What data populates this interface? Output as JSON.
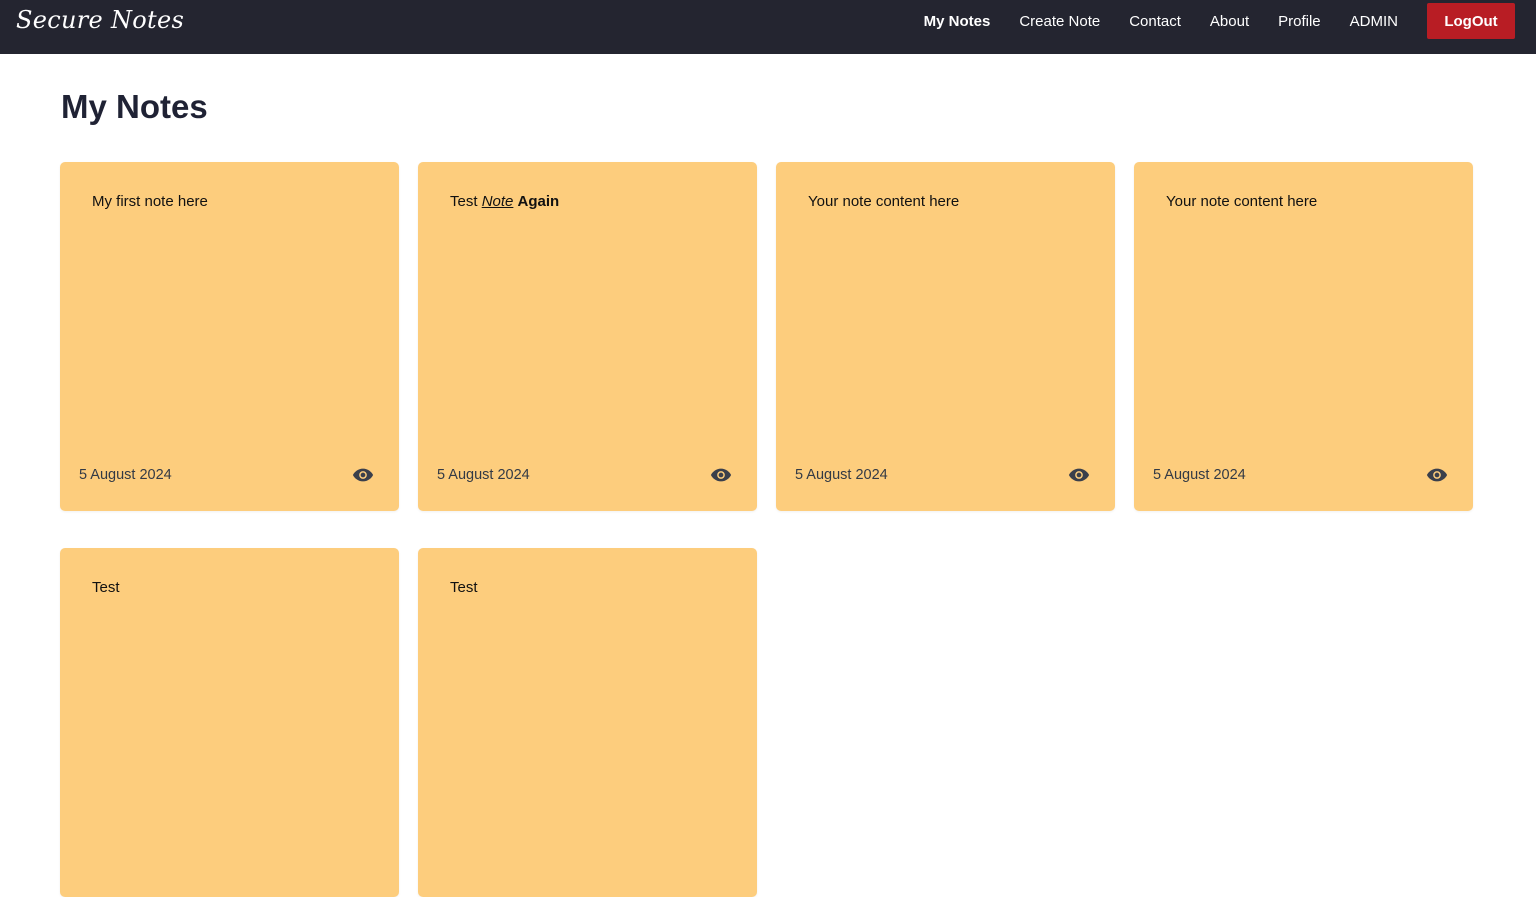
{
  "nav": {
    "brand": "Secure Notes",
    "links": [
      {
        "label": "My Notes",
        "active": true
      },
      {
        "label": "Create Note",
        "active": false
      },
      {
        "label": "Contact",
        "active": false
      },
      {
        "label": "About",
        "active": false
      },
      {
        "label": "Profile",
        "active": false
      },
      {
        "label": "ADMIN",
        "active": false
      }
    ],
    "logout_label": "LogOut"
  },
  "page": {
    "title": "My Notes"
  },
  "notes": [
    {
      "content_parts": [
        {
          "text": "My first note here",
          "style": "normal"
        }
      ],
      "date": "5 August 2024",
      "view_icon": "eye-icon"
    },
    {
      "content_parts": [
        {
          "text": "Test ",
          "style": "normal"
        },
        {
          "text": "Note",
          "style": "italic-underline"
        },
        {
          "text": " ",
          "style": "normal"
        },
        {
          "text": "Again",
          "style": "bold"
        }
      ],
      "date": "5 August 2024",
      "view_icon": "eye-icon"
    },
    {
      "content_parts": [
        {
          "text": "Your note content here",
          "style": "normal"
        }
      ],
      "date": "5 August 2024",
      "view_icon": "eye-icon"
    },
    {
      "content_parts": [
        {
          "text": "Your note content here",
          "style": "normal"
        }
      ],
      "date": "5 August 2024",
      "view_icon": "eye-icon"
    },
    {
      "content_parts": [
        {
          "text": "Test",
          "style": "normal"
        }
      ],
      "date": "",
      "view_icon": "eye-icon"
    },
    {
      "content_parts": [
        {
          "text": "Test",
          "style": "normal"
        }
      ],
      "date": "",
      "view_icon": "eye-icon"
    }
  ],
  "colors": {
    "navbar_bg": "#242530",
    "note_bg": "#fdcd7d",
    "logout_bg": "#b81d24",
    "title_text": "#1f2234"
  }
}
